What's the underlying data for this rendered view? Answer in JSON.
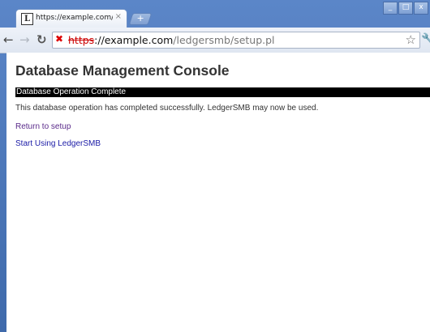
{
  "browser": {
    "tab_title": "https://example.com/ledge",
    "tab_favicon_letter": "L",
    "tab_close": "×",
    "new_tab": "+",
    "window_buttons": {
      "minimize": "_",
      "maximize": "□",
      "close": "x"
    },
    "address": {
      "proto": "https",
      "host_part": "://example.com",
      "path": "/ledgersmb/setup.pl"
    }
  },
  "page": {
    "heading": "Database Management Console",
    "status_banner": "Database Operation Complete",
    "message": "This database operation has completed successfully.  LedgerSMB may now be used.",
    "links": {
      "return_setup": "Return to setup",
      "start_using": "Start Using LedgerSMB"
    }
  }
}
